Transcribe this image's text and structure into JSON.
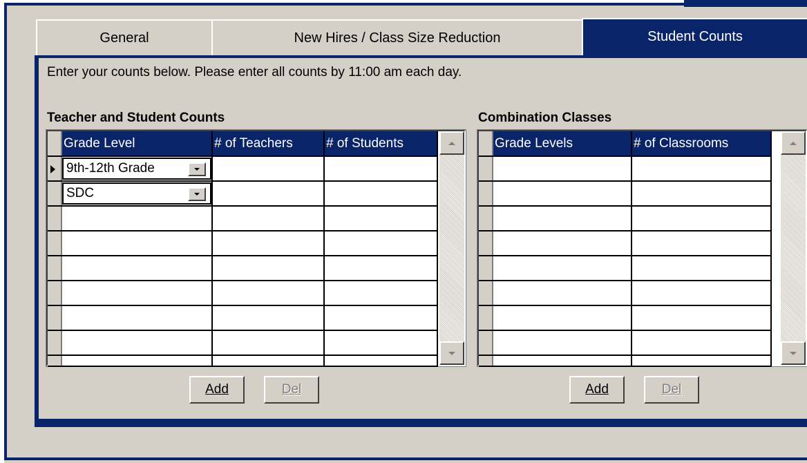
{
  "tabs": [
    {
      "label": "General",
      "active": false
    },
    {
      "label": "New Hires / Class Size Reduction",
      "active": false
    },
    {
      "label": "Student Counts",
      "active": true
    }
  ],
  "instruction": "Enter your counts below.  Please enter all counts by 11:00 am each day.",
  "teacher_section": {
    "title": "Teacher and Student Counts",
    "columns": [
      "Grade Level",
      "# of Teachers",
      "# of Students"
    ],
    "rows": [
      {
        "grade_level": "9th-12th Grade",
        "teachers": "",
        "students": ""
      },
      {
        "grade_level": "SDC",
        "teachers": "",
        "students": ""
      }
    ],
    "add_label": "Add",
    "del_label": "Del"
  },
  "combination_section": {
    "title": "Combination Classes",
    "columns": [
      "Grade Levels",
      "# of Classrooms"
    ],
    "rows": [],
    "add_label": "Add",
    "del_label": "Del"
  },
  "colors": {
    "window_face": "#d4d0c8",
    "accent_navy": "#0a246a",
    "header_text": "#ffffff",
    "disabled_text": "#808080"
  },
  "icons": {
    "dropdown": "chevron-down-icon",
    "scroll_up": "scroll-up-arrow-icon",
    "scroll_down": "scroll-down-arrow-icon",
    "current_row": "row-pointer-icon"
  }
}
